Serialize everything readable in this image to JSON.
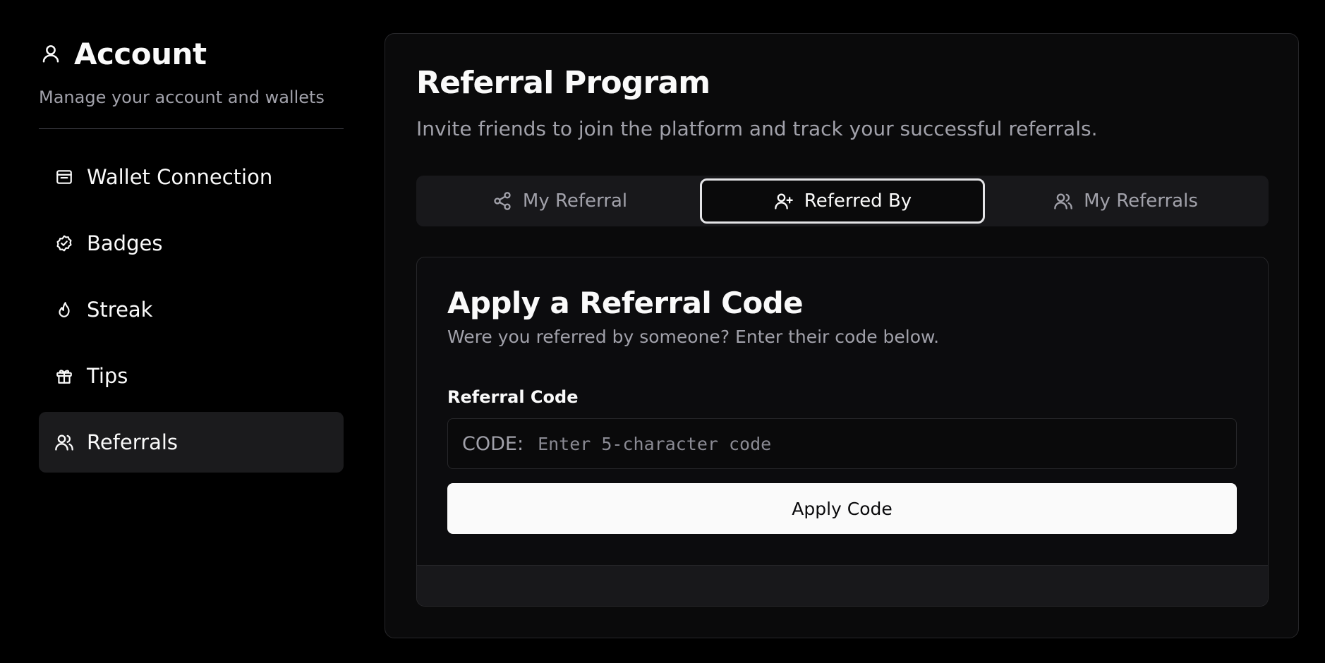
{
  "sidebar": {
    "title": "Account",
    "title_icon": "user-icon",
    "subtitle": "Manage your account and wallets",
    "items": [
      {
        "label": "Wallet Connection",
        "icon": "wallet-icon"
      },
      {
        "label": "Badges",
        "icon": "badge-check-icon"
      },
      {
        "label": "Streak",
        "icon": "flame-icon"
      },
      {
        "label": "Tips",
        "icon": "gift-icon"
      },
      {
        "label": "Referrals",
        "icon": "users-icon",
        "active": true
      }
    ]
  },
  "main": {
    "title": "Referral Program",
    "subtitle": "Invite friends to join the platform and track your successful referrals.",
    "tabs": [
      {
        "label": "My Referral",
        "icon": "share-icon"
      },
      {
        "label": "Referred By",
        "icon": "user-plus-icon",
        "active": true
      },
      {
        "label": "My Referrals",
        "icon": "users-icon"
      }
    ],
    "apply": {
      "title": "Apply a Referral Code",
      "subtitle": "Were you referred by someone? Enter their code below.",
      "field_label": "Referral Code",
      "prefix": "CODE:",
      "placeholder": "Enter 5-character code",
      "value": "",
      "button_label": "Apply Code"
    }
  },
  "colors": {
    "background": "#000000",
    "card": "#0a0a0b",
    "muted_text": "#a1a1aa",
    "button_bg": "#fafafa",
    "active_border": "#e4e4e7"
  }
}
